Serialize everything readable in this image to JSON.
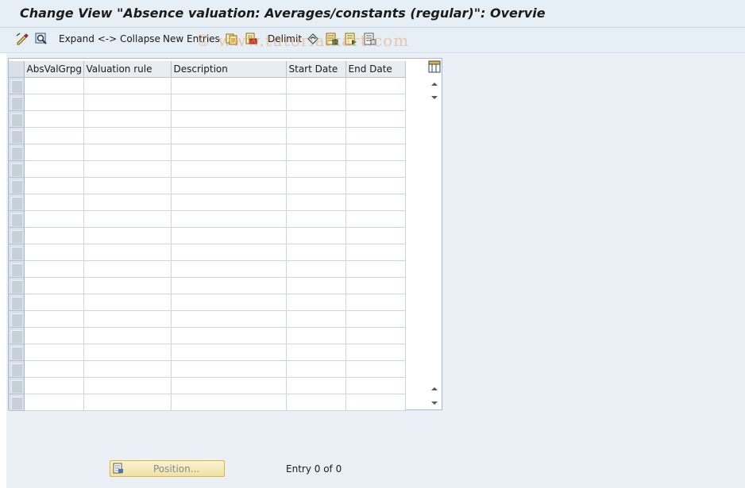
{
  "window": {
    "title": "Change View \"Absence valuation: Averages/constants (regular)\": Overvie"
  },
  "toolbar": {
    "expand_collapse_label": "Expand <-> Collapse",
    "new_entries_label": "New Entries",
    "delimit_label": "Delimit",
    "watermark": "© www.tutorialkart.com"
  },
  "table": {
    "columns": [
      "AbsValGrpg",
      "Valuation rule",
      "Description",
      "Start Date",
      "End Date"
    ],
    "row_count": 20
  },
  "footer": {
    "position_label": "Position...",
    "entry_text": "Entry 0 of 0"
  },
  "colors": {
    "title_bg": "#e6eef6",
    "content_bg": "#eaf0f6",
    "button_bg": "#f4e8b6"
  }
}
